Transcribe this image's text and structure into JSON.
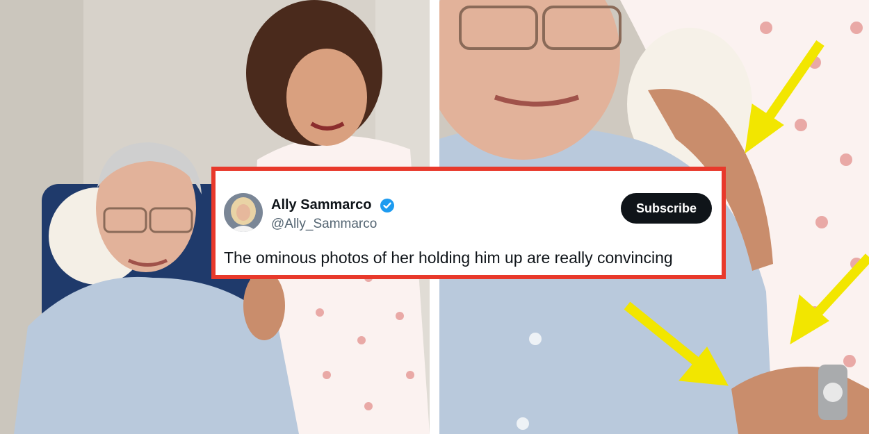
{
  "tweet": {
    "name": "Ally Sammarco",
    "handle": "@Ally_Sammarco",
    "subscribe_label": "Subscribe",
    "text": "The ominous photos of her holding him up are really convincing",
    "verified": true
  },
  "colors": {
    "card_border": "#e8392b",
    "arrow": "#f2e600",
    "verified_badge": "#1d9bf0",
    "subscribe_bg": "#0f1419"
  },
  "icons": {
    "verified": "verified-badge-icon",
    "arrow": "yellow-arrow-icon"
  }
}
